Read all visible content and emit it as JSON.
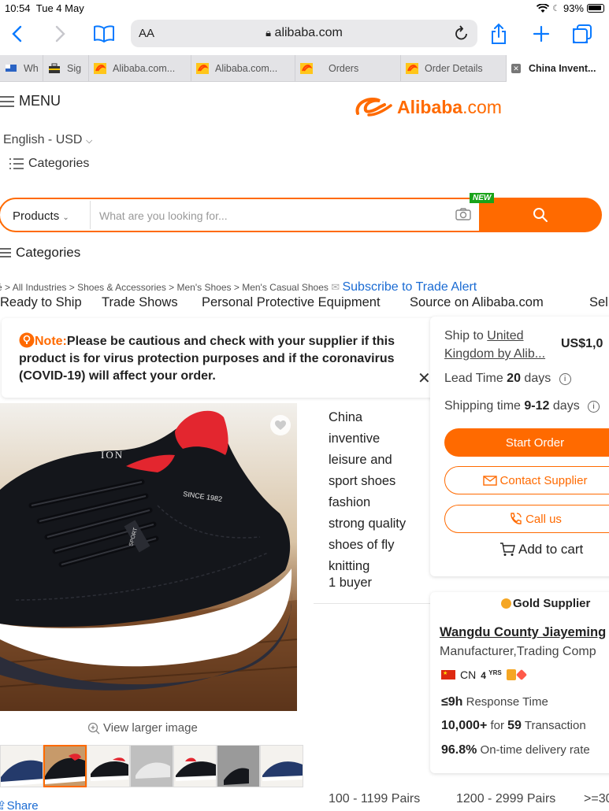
{
  "status_bar": {
    "time": "10:54",
    "date": "Tue 4 May",
    "battery": "93%"
  },
  "browser": {
    "text_size_label": "AA",
    "url": "alibaba.com",
    "tabs": [
      {
        "label": "Wh"
      },
      {
        "label": "Sig"
      },
      {
        "label": "Alibaba.com..."
      },
      {
        "label": "Alibaba.com..."
      },
      {
        "label": "Orders"
      },
      {
        "label": "Order Details"
      },
      {
        "label": "China Invent..."
      }
    ]
  },
  "header": {
    "menu_label": "MENU",
    "brand": "Alibaba",
    "brand_tld": ".com",
    "language": "English - USD",
    "categories_label": "Categories"
  },
  "search": {
    "category": "Products",
    "placeholder": "What are you looking for...",
    "new_badge": "NEW"
  },
  "categories2_label": "Categories",
  "breadcrumb": {
    "items": [
      "é",
      "All Industries",
      "Shoes & Accessories",
      "Men's Shoes",
      "Men's Casual Shoes"
    ],
    "subscribe": "Subscribe to Trade Alert"
  },
  "nav_links": [
    "Ready to Ship",
    "Trade Shows",
    "Personal Protective Equipment",
    "Source on Alibaba.com",
    "Sell"
  ],
  "note": {
    "label": "Note:",
    "text": "Please be cautious and check with your supplier if this product is for virus protection purposes and if the coronavirus (COVID-19) will affect your order."
  },
  "order_panel": {
    "ship_to": "Ship to",
    "ship_country": "United",
    "ship_by": "Kingdom by Alib...",
    "price": "US$1,0",
    "lead_label": "Lead Time",
    "lead_value": "20",
    "lead_unit": "days",
    "shipping_label": "Shipping time",
    "shipping_value": "9-12",
    "shipping_unit": "days",
    "start_order": "Start Order",
    "contact_supplier": "Contact Supplier",
    "call_us": "Call us",
    "add_to_cart": "Add to cart"
  },
  "product": {
    "title_lines": [
      "China",
      "inventive",
      "leisure and",
      "sport shoes",
      "fashion",
      "strong quality",
      "shoes of fly",
      "knitting"
    ],
    "buyers": "1 buyer",
    "shoe_text_1": "SINCE 1982",
    "shoe_text_2": "ION",
    "shoe_text_3": "SPORT",
    "view_larger": "View larger image",
    "share": "Share"
  },
  "supplier": {
    "badge": "Gold Supplier",
    "name": "Wangdu County Jiayeming",
    "type": "Manufacturer,Trading Comp",
    "country": "CN",
    "years": "4",
    "years_unit": "YRS",
    "response_value": "≤9h",
    "response_label": "Response Time",
    "transactions_value": "10,000+",
    "transactions_mid": "for",
    "transactions_count": "59",
    "transactions_label": "Transaction",
    "ontime_value": "96.8%",
    "ontime_label": "On-time delivery rate"
  },
  "price_ladder": [
    "100 - 1199 Pairs",
    "1200 - 2999 Pairs",
    ">=30"
  ],
  "colors": {
    "accent": "#ff6a00",
    "link": "#1a6bd3",
    "ios_blue": "#0a7aff",
    "new_badge": "#1aa31a"
  }
}
